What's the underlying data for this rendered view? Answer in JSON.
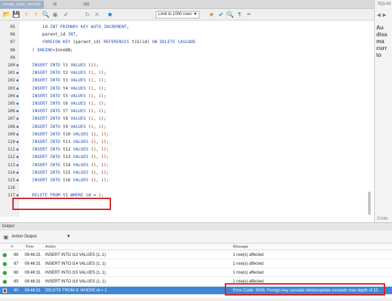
{
  "tabs": [
    {
      "label": "create_table_level16"
    },
    {
      "label": "t1"
    },
    {
      "label": "t10"
    }
  ],
  "toolbar": {
    "icons": [
      "folder-open-icon",
      "save-icon",
      "lightning-icon",
      "lightning-cursor-icon",
      "magnifier-icon",
      "stop-icon",
      "commit-icon",
      "rollback-icon",
      "toggle-icon",
      "autocommit-icon"
    ],
    "limit_label": "Limit to 1000 rows"
  },
  "sidebar": {
    "title": "SQLAd",
    "message": "Au\ndisa\nma\ncurr\nto",
    "footer": "Conte"
  },
  "editor": {
    "lines": [
      {
        "n": "95",
        "dot": false,
        "code": "        id INT PRIMARY KEY AUTO_INCREMENT,"
      },
      {
        "n": "96",
        "dot": false,
        "code": "        parent_id INT,"
      },
      {
        "n": "97",
        "dot": false,
        "code": "        FOREIGN KEY (parent_id) REFERENCES t15(id) ON DELETE CASCADE"
      },
      {
        "n": "98",
        "dot": false,
        "code": "    ) ENGINE=InnoDB;"
      },
      {
        "n": "99",
        "dot": false,
        "code": ""
      },
      {
        "n": "100",
        "dot": true,
        "code": "    INSERT INTO t1 VALUES (1);"
      },
      {
        "n": "101",
        "dot": true,
        "code": "    INSERT INTO t2 VALUES (1, 1);"
      },
      {
        "n": "102",
        "dot": true,
        "code": "    INSERT INTO t3 VALUES (1, 1);"
      },
      {
        "n": "103",
        "dot": true,
        "code": "    INSERT INTO t4 VALUES (1, 1);"
      },
      {
        "n": "104",
        "dot": true,
        "code": "    INSERT INTO t5 VALUES (1, 1);"
      },
      {
        "n": "105",
        "dot": true,
        "code": "    INSERT INTO t6 VALUES (1, 1);"
      },
      {
        "n": "106",
        "dot": true,
        "code": "    INSERT INTO t7 VALUES (1, 1);"
      },
      {
        "n": "107",
        "dot": true,
        "code": "    INSERT INTO t8 VALUES (1, 1);"
      },
      {
        "n": "108",
        "dot": true,
        "code": "    INSERT INTO t9 VALUES (1, 1);"
      },
      {
        "n": "109",
        "dot": true,
        "code": "    INSERT INTO t10 VALUES (1, 1);"
      },
      {
        "n": "110",
        "dot": true,
        "code": "    INSERT INTO t11 VALUES (1, 1);"
      },
      {
        "n": "111",
        "dot": true,
        "code": "    INSERT INTO t12 VALUES (1, 1);"
      },
      {
        "n": "112",
        "dot": true,
        "code": "    INSERT INTO t13 VALUES (1, 1);"
      },
      {
        "n": "113",
        "dot": true,
        "code": "    INSERT INTO t14 VALUES (1, 1);"
      },
      {
        "n": "114",
        "dot": true,
        "code": "    INSERT INTO t15 VALUES (1, 1);"
      },
      {
        "n": "115",
        "dot": true,
        "code": "    INSERT INTO t16 VALUES (1, 1);"
      },
      {
        "n": "116",
        "dot": false,
        "code": ""
      },
      {
        "n": "117",
        "dot": true,
        "code": "    DELETE FROM t1 WHERE id = 1;"
      }
    ]
  },
  "output": {
    "title": "Output",
    "selector": "Action Output",
    "columns": {
      "num": "#",
      "time": "Time",
      "action": "Action",
      "message": "Message"
    },
    "rows": [
      {
        "num": "86",
        "time": "08:46:31",
        "action": "INSERT INTO t13 VALUES (1, 1)",
        "message": "1 row(s) affected",
        "status": "ok"
      },
      {
        "num": "87",
        "time": "08:46:31",
        "action": "INSERT INTO t14 VALUES (1, 1)",
        "message": "1 row(s) affected",
        "status": "ok"
      },
      {
        "num": "88",
        "time": "08:46:31",
        "action": "INSERT INTO t15 VALUES (1, 1)",
        "message": "1 row(s) affected",
        "status": "ok"
      },
      {
        "num": "89",
        "time": "08:46:31",
        "action": "INSERT INTO t16 VALUES (1, 1)",
        "message": "1 row(s) affected",
        "status": "ok"
      },
      {
        "num": "90",
        "time": "08:46:31",
        "action": "DELETE FROM t1 WHERE id = 1",
        "message": "Error Code: 3008. Foreign key cascade delete/update exceeds max depth of 15.",
        "status": "error"
      }
    ]
  },
  "colors": {
    "highlight": "#d42026",
    "selection": "#3e86d6",
    "ok": "#32a83c",
    "error": "#d62f2f"
  }
}
